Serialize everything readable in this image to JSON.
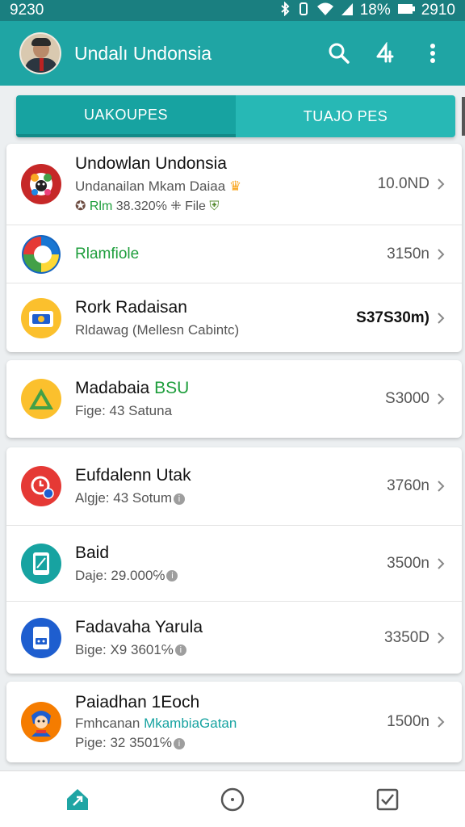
{
  "status_bar": {
    "time": "9230",
    "battery": "18%",
    "clock_right": "2910",
    "icons": [
      "bluetooth-icon",
      "vibrate-icon",
      "wifi-icon",
      "signal-icon",
      "battery-icon"
    ]
  },
  "app_bar": {
    "title": "Undalı Undonsia",
    "icons": [
      "avatar",
      "search-icon",
      "share-icon",
      "more-vert-icon"
    ]
  },
  "tabs": [
    {
      "label": "UAKOUPES",
      "active": true
    },
    {
      "label": "TUAJO PES",
      "active": false
    }
  ],
  "cards": [
    {
      "rows": [
        {
          "title": "Undowlan Undonsia",
          "line2": "Undanailan Mkam Daiaa",
          "line3_green": "Rlm",
          "line3": "38.320℅ ⁜ File",
          "value": "10.0ND",
          "icon": "flower-badge-icon",
          "icon_color": "#c62828"
        },
        {
          "title": "Rlamfiole",
          "value": "3150n",
          "icon": "google-photos-icon",
          "icon_color": "#1565c0",
          "title_color": "#1e9e3c"
        },
        {
          "title": "Rork Radaisan",
          "line2": "Rldawag (Mellesn Cabintc)",
          "value": "S37S30m)",
          "icon": "camera-icon",
          "icon_color": "#fbc02d"
        }
      ]
    },
    {
      "rows": [
        {
          "title": "Madabaia",
          "title_suffix": "BSU",
          "line2": "Fige: 43 Satuna",
          "value": "S3000",
          "icon": "drive-icon",
          "icon_color": "#fbc02d"
        }
      ]
    },
    {
      "rows": [
        {
          "title": "Eufdalenn Utak",
          "line2": "Algje: 43 Sotum",
          "value": "3760n",
          "icon": "timer-badge-icon",
          "icon_color": "#e53935"
        },
        {
          "title": "Baid",
          "line2": "Daje: 29.000℅",
          "value": "3500n",
          "icon": "phone-app-icon",
          "icon_color": "#17a3a1"
        },
        {
          "title": "Fadavaha Yarula",
          "line2": "Bige: X9 3601℅",
          "value": "3350D",
          "icon": "game-card-icon",
          "icon_color": "#1e5ecf"
        }
      ]
    },
    {
      "rows": [
        {
          "title": "Paiadhan 1Eoch",
          "line2": "Fmhcanan",
          "line2_green": "MkambiaGatan",
          "line3": "Pige: 32 3501℅",
          "value": "1500n",
          "icon": "character-icon",
          "icon_color": "#f57c00"
        }
      ]
    }
  ],
  "bottom_nav": [
    "home-icon",
    "compass-icon",
    "checkbox-icon"
  ]
}
